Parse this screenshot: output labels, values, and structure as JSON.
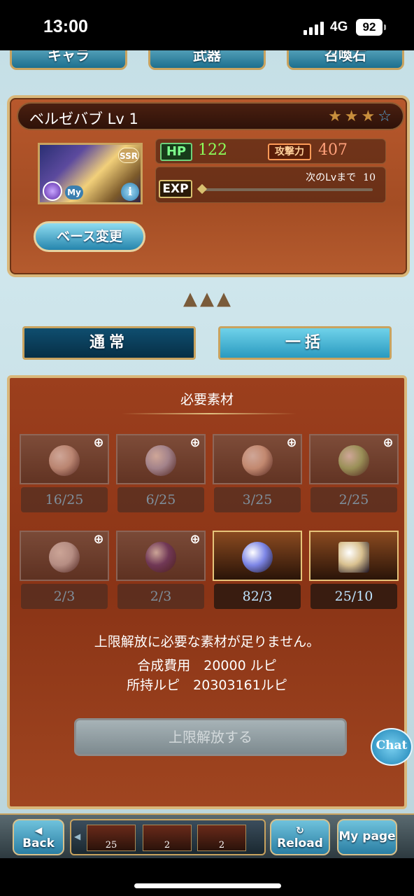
{
  "status": {
    "time": "13:00",
    "network": "4G",
    "battery": "92"
  },
  "top_tabs": [
    "キャラ",
    "武器",
    "召喚石"
  ],
  "character": {
    "name": "ベルゼバブ Lv 1",
    "stars_filled": 3,
    "stars_total": 4,
    "rarity": "SSR",
    "my_badge": "My",
    "info_label": "i",
    "hp_label": "HP",
    "hp": "122",
    "atk_label": "攻撃力",
    "atk": "407",
    "exp_label": "EXP",
    "exp_next_label": "次のLvまで",
    "exp_next_value": "10",
    "base_change": "ベース変更"
  },
  "mode_buttons": {
    "normal": "通常",
    "bulk": "一括"
  },
  "materials": {
    "title": "必要素材",
    "items": [
      {
        "count": "16/25",
        "state": "dim",
        "orb": "#d9c2b8"
      },
      {
        "count": "6/25",
        "state": "dim",
        "orb": "#aebde6"
      },
      {
        "count": "3/25",
        "state": "dim",
        "orb": "#e8c9b6"
      },
      {
        "count": "2/25",
        "state": "dim",
        "orb": "#9fd68a"
      },
      {
        "count": "2/3",
        "state": "dim",
        "orb": "#d8d6dc"
      },
      {
        "count": "2/3",
        "state": "dim",
        "orb": "#5a3a8a"
      },
      {
        "count": "82/3",
        "state": "lit",
        "orb": "#7d86e6"
      },
      {
        "count": "25/10",
        "state": "lit",
        "orb": "#d9c190"
      }
    ],
    "message": "上限解放に必要な素材が足りません。",
    "cost_line": "合成費用　20000 ルピ",
    "owned_line": "所持ルピ　20303161ルピ",
    "uncap_button": "上限解放する"
  },
  "chat_label": "Chat",
  "bottom_nav": {
    "back": "Back",
    "reload": "Reload",
    "mypage": "My page",
    "strip_counts": [
      "25",
      "2",
      "2"
    ]
  }
}
